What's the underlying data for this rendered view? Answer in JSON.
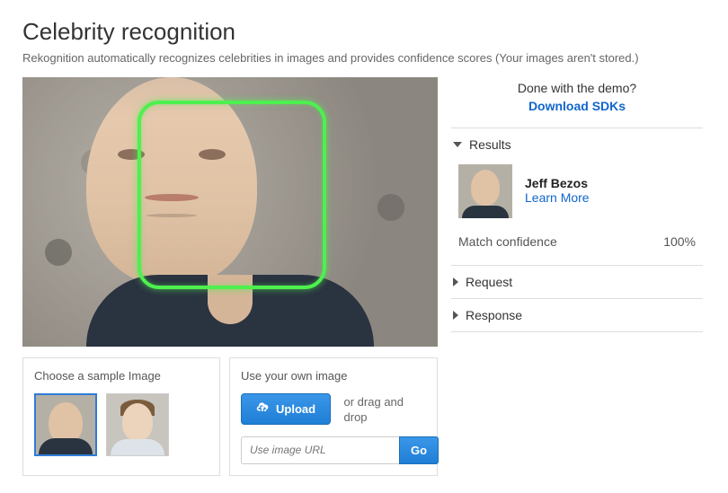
{
  "header": {
    "title": "Celebrity recognition",
    "subtitle": "Rekognition automatically recognizes celebrities in images and provides confidence scores (Your images aren't stored.)"
  },
  "samples": {
    "label": "Choose a sample Image"
  },
  "own_image": {
    "label": "Use your own image",
    "upload_button": "Upload",
    "drag_hint": "or drag and drop",
    "url_placeholder": "Use image URL",
    "go_button": "Go"
  },
  "sidebar": {
    "demo_done": "Done with the demo?",
    "download_link": "Download SDKs",
    "sections": {
      "results": "Results",
      "request": "Request",
      "response": "Response"
    }
  },
  "result": {
    "name": "Jeff Bezos",
    "learn_more": "Learn More",
    "confidence_label": "Match confidence",
    "confidence_value": "100%"
  }
}
